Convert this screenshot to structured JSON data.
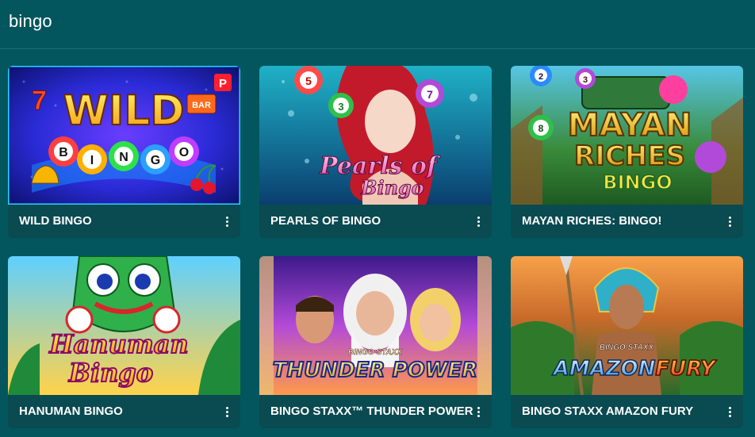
{
  "search": {
    "query": "bingo"
  },
  "games": [
    {
      "title": "WILD BINGO",
      "art_text": [
        "WILD",
        "B",
        "I",
        "N",
        "G",
        "O"
      ],
      "badge": "P",
      "reel_text": "BAR"
    },
    {
      "title": "PEARLS OF BINGO",
      "art_text": [
        "Pearls of",
        "Bingo"
      ],
      "balls": [
        "5",
        "3",
        "7"
      ]
    },
    {
      "title": "MAYAN RICHES: BINGO!",
      "art_text": [
        "MAYAN",
        "RICHES",
        "BINGO"
      ],
      "balls": [
        "2",
        "3",
        "8"
      ]
    },
    {
      "title": "HANUMAN BINGO",
      "art_text": [
        "Hanuman",
        "Bingo"
      ]
    },
    {
      "title": "BINGO STAXX™ THUNDER POWER",
      "art_text": [
        "BINGO STAXX",
        "THUNDER POWER"
      ]
    },
    {
      "title": "BINGO STAXX AMAZON FURY",
      "art_text": [
        "BINGO STAXX",
        "AMAZON",
        "FURY"
      ]
    }
  ],
  "colors": {
    "background": "#03565e",
    "card_bar": "#0a4a51",
    "text": "#ffffff"
  }
}
